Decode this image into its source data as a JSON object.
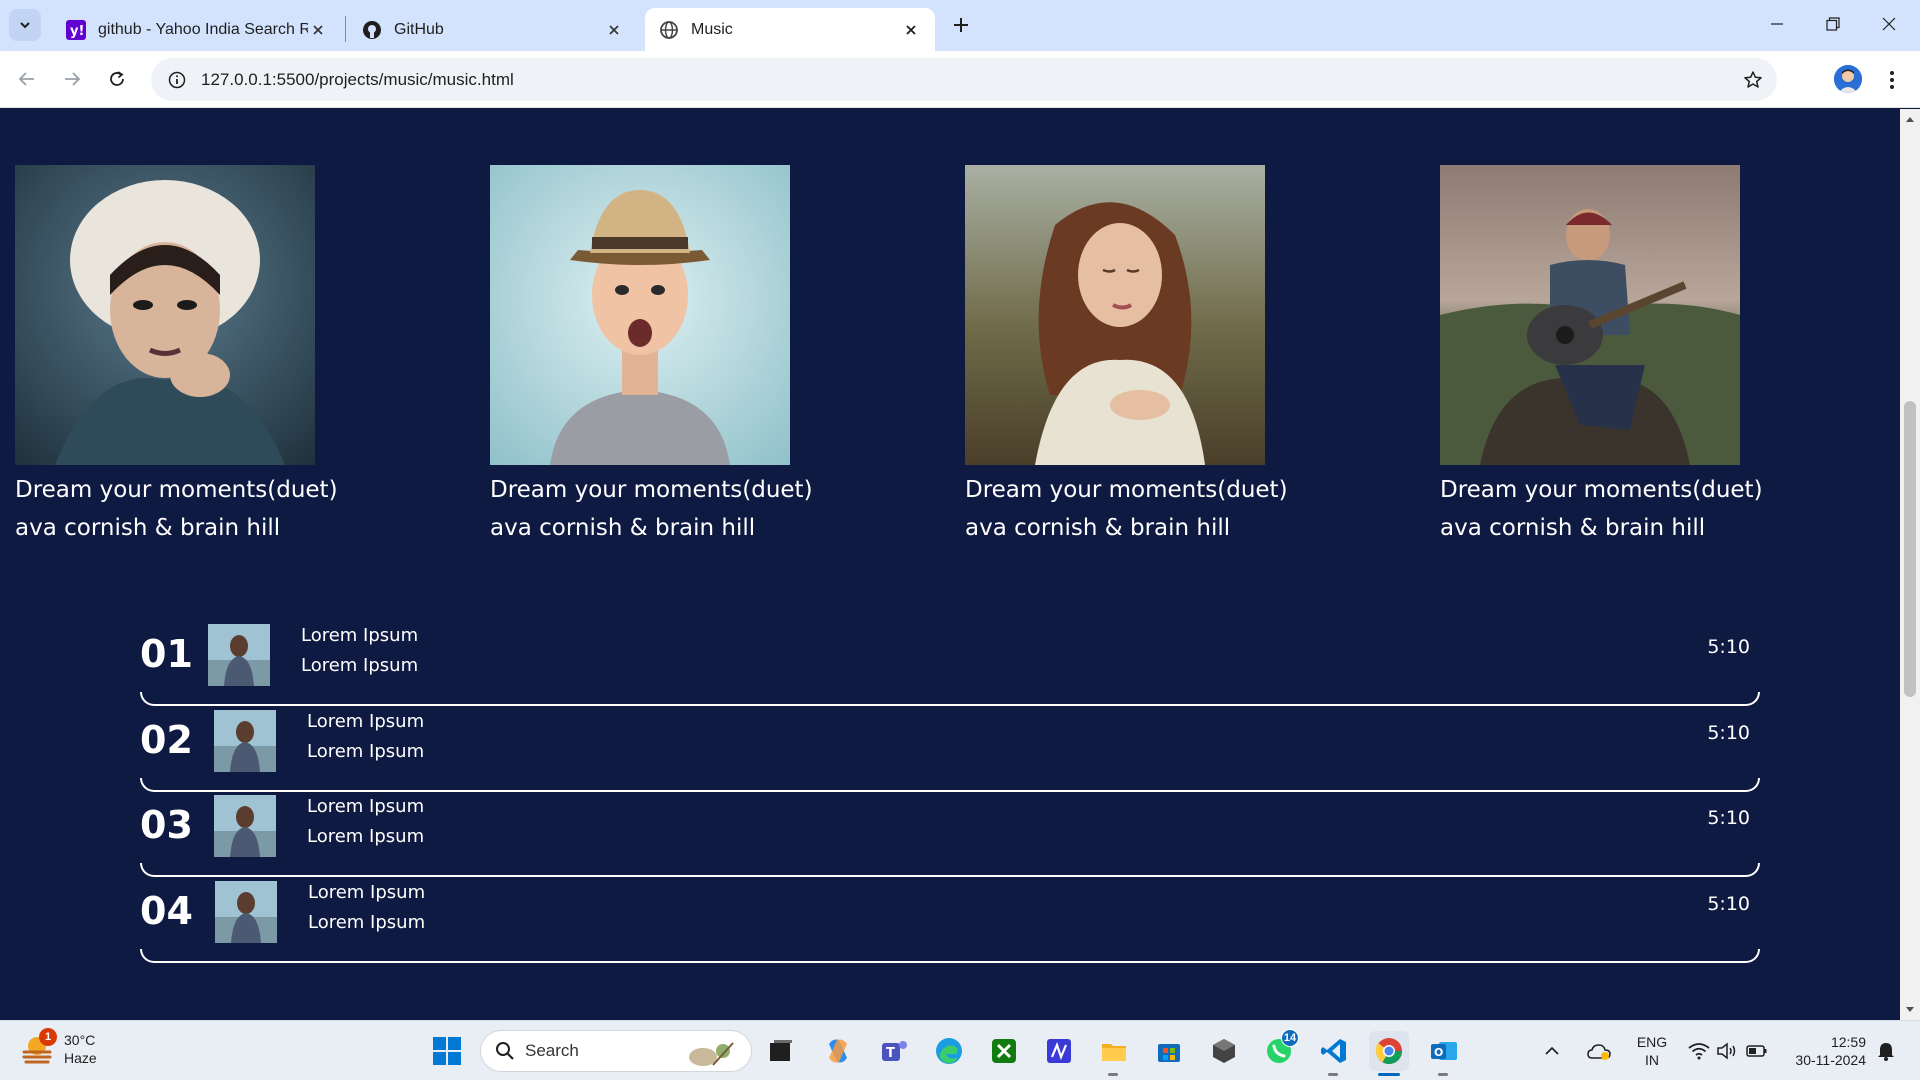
{
  "browser": {
    "tabs": [
      {
        "title": "github - Yahoo India Search Re",
        "icon": "yahoo-icon",
        "active": false
      },
      {
        "title": "GitHub",
        "icon": "github-icon",
        "active": false
      },
      {
        "title": "Music",
        "icon": "globe-icon",
        "active": true
      }
    ],
    "url": "127.0.0.1:5500/projects/music/music.html"
  },
  "page": {
    "background": "#0f1a42",
    "cards": [
      {
        "title": "Dream your moments(duet)",
        "artists": "ava cornish & brain hill"
      },
      {
        "title": "Dream your moments(duet)",
        "artists": "ava cornish & brain hill"
      },
      {
        "title": "Dream your moments(duet)",
        "artists": "ava cornish & brain hill"
      },
      {
        "title": "Dream your moments(duet)",
        "artists": "ava cornish & brain hill"
      }
    ],
    "tracks": [
      {
        "number": "01",
        "line1": "Lorem Ipsum",
        "line2": "Lorem Ipsum",
        "duration": "5:10"
      },
      {
        "number": "02",
        "line1": "Lorem Ipsum",
        "line2": "Lorem Ipsum",
        "duration": "5:10"
      },
      {
        "number": "03",
        "line1": "Lorem Ipsum",
        "line2": "Lorem Ipsum",
        "duration": "5:10"
      },
      {
        "number": "04",
        "line1": "Lorem Ipsum",
        "line2": "Lorem Ipsum",
        "duration": "5:10"
      }
    ]
  },
  "taskbar": {
    "weather": {
      "temp": "30°C",
      "condition": "Haze",
      "badge": "1"
    },
    "search_placeholder": "Search",
    "whatsapp_badge": "14",
    "lang": {
      "line1": "ENG",
      "line2": "IN"
    },
    "clock": {
      "time": "12:59",
      "date": "30-11-2024"
    }
  }
}
